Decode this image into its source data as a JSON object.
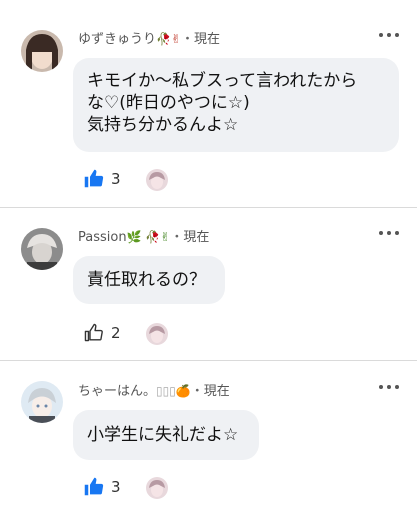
{
  "comments": [
    {
      "author": "ゆずきゅうり",
      "author_emoji": "🥀✌",
      "separator": "・",
      "time": "現在",
      "text": "キモイか〜私ブスって言われたから\nな♡(昨日のやつに☆)\n気持ち分かるんよ☆",
      "likes": "3",
      "liked": true
    },
    {
      "author": "Passion",
      "author_emoji": "🌿 🥀✌",
      "separator": "・",
      "time": "現在",
      "text": "責任取れるの？",
      "likes": "2",
      "liked": false
    },
    {
      "author": "ちゃーはん。",
      "author_emoji": "▯▯▯🍊",
      "separator": "・",
      "time": "現在",
      "text": "小学生に失礼だよ☆",
      "likes": "3",
      "liked": true
    }
  ],
  "colors": {
    "like_active": "#1877f2",
    "bubble_bg": "#eff1f4",
    "divider": "#dadada"
  }
}
